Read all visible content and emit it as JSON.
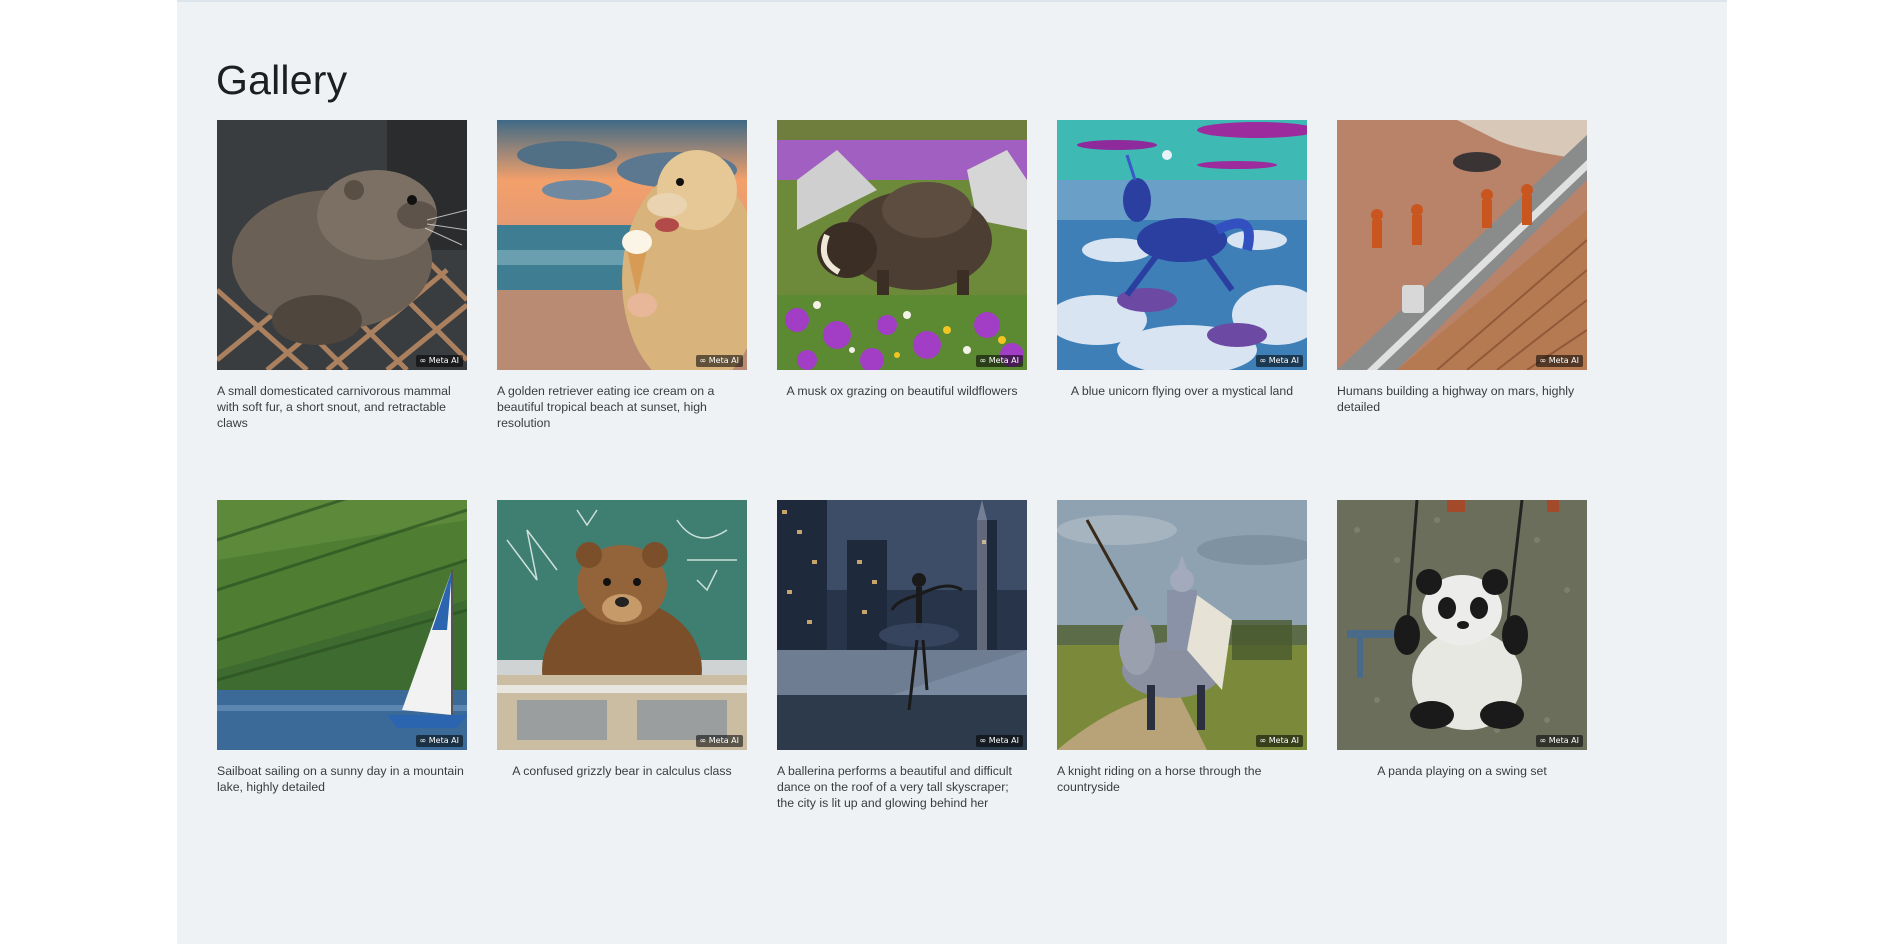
{
  "gallery": {
    "title": "Gallery",
    "watermark": "∞ Meta AI",
    "items": [
      {
        "caption": "A small domesticated carnivorous mammal with soft fur, a short snout, and retractable claws",
        "align": "left",
        "art": "ferret"
      },
      {
        "caption": "A golden retriever eating ice cream on a beautiful tropical beach at sunset, high resolution",
        "align": "left",
        "art": "dog-beach"
      },
      {
        "caption": "A musk ox grazing on beautiful wildflowers",
        "align": "center",
        "art": "musk-ox"
      },
      {
        "caption": "A blue unicorn flying over a mystical land",
        "align": "center",
        "art": "unicorn"
      },
      {
        "caption": "Humans building a highway on mars, highly detailed",
        "align": "left",
        "art": "mars-highway"
      },
      {
        "caption": "Sailboat sailing on a sunny day in a mountain lake, highly detailed",
        "align": "left",
        "art": "sailboat"
      },
      {
        "caption": "A confused grizzly bear in calculus class",
        "align": "center",
        "art": "bear-class"
      },
      {
        "caption": "A ballerina performs a beautiful and difficult dance on the roof of a very tall skyscraper; the city is lit up and glowing behind her",
        "align": "left",
        "art": "ballerina"
      },
      {
        "caption": "A knight riding on a horse through the countryside",
        "align": "left",
        "art": "knight"
      },
      {
        "caption": "A panda playing on a swing set",
        "align": "center",
        "art": "panda"
      }
    ]
  }
}
